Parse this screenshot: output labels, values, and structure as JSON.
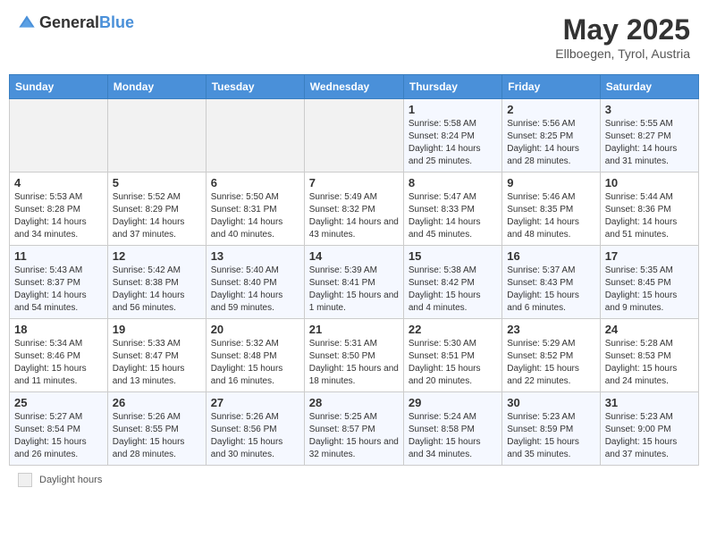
{
  "header": {
    "logo_general": "General",
    "logo_blue": "Blue",
    "month_title": "May 2025",
    "subtitle": "Ellboegen, Tyrol, Austria"
  },
  "legend": {
    "label": "Daylight hours"
  },
  "days_of_week": [
    "Sunday",
    "Monday",
    "Tuesday",
    "Wednesday",
    "Thursday",
    "Friday",
    "Saturday"
  ],
  "weeks": [
    [
      {
        "day": "",
        "detail": ""
      },
      {
        "day": "",
        "detail": ""
      },
      {
        "day": "",
        "detail": ""
      },
      {
        "day": "",
        "detail": ""
      },
      {
        "day": "1",
        "detail": "Sunrise: 5:58 AM\nSunset: 8:24 PM\nDaylight: 14 hours and 25 minutes."
      },
      {
        "day": "2",
        "detail": "Sunrise: 5:56 AM\nSunset: 8:25 PM\nDaylight: 14 hours and 28 minutes."
      },
      {
        "day": "3",
        "detail": "Sunrise: 5:55 AM\nSunset: 8:27 PM\nDaylight: 14 hours and 31 minutes."
      }
    ],
    [
      {
        "day": "4",
        "detail": "Sunrise: 5:53 AM\nSunset: 8:28 PM\nDaylight: 14 hours and 34 minutes."
      },
      {
        "day": "5",
        "detail": "Sunrise: 5:52 AM\nSunset: 8:29 PM\nDaylight: 14 hours and 37 minutes."
      },
      {
        "day": "6",
        "detail": "Sunrise: 5:50 AM\nSunset: 8:31 PM\nDaylight: 14 hours and 40 minutes."
      },
      {
        "day": "7",
        "detail": "Sunrise: 5:49 AM\nSunset: 8:32 PM\nDaylight: 14 hours and 43 minutes."
      },
      {
        "day": "8",
        "detail": "Sunrise: 5:47 AM\nSunset: 8:33 PM\nDaylight: 14 hours and 45 minutes."
      },
      {
        "day": "9",
        "detail": "Sunrise: 5:46 AM\nSunset: 8:35 PM\nDaylight: 14 hours and 48 minutes."
      },
      {
        "day": "10",
        "detail": "Sunrise: 5:44 AM\nSunset: 8:36 PM\nDaylight: 14 hours and 51 minutes."
      }
    ],
    [
      {
        "day": "11",
        "detail": "Sunrise: 5:43 AM\nSunset: 8:37 PM\nDaylight: 14 hours and 54 minutes."
      },
      {
        "day": "12",
        "detail": "Sunrise: 5:42 AM\nSunset: 8:38 PM\nDaylight: 14 hours and 56 minutes."
      },
      {
        "day": "13",
        "detail": "Sunrise: 5:40 AM\nSunset: 8:40 PM\nDaylight: 14 hours and 59 minutes."
      },
      {
        "day": "14",
        "detail": "Sunrise: 5:39 AM\nSunset: 8:41 PM\nDaylight: 15 hours and 1 minute."
      },
      {
        "day": "15",
        "detail": "Sunrise: 5:38 AM\nSunset: 8:42 PM\nDaylight: 15 hours and 4 minutes."
      },
      {
        "day": "16",
        "detail": "Sunrise: 5:37 AM\nSunset: 8:43 PM\nDaylight: 15 hours and 6 minutes."
      },
      {
        "day": "17",
        "detail": "Sunrise: 5:35 AM\nSunset: 8:45 PM\nDaylight: 15 hours and 9 minutes."
      }
    ],
    [
      {
        "day": "18",
        "detail": "Sunrise: 5:34 AM\nSunset: 8:46 PM\nDaylight: 15 hours and 11 minutes."
      },
      {
        "day": "19",
        "detail": "Sunrise: 5:33 AM\nSunset: 8:47 PM\nDaylight: 15 hours and 13 minutes."
      },
      {
        "day": "20",
        "detail": "Sunrise: 5:32 AM\nSunset: 8:48 PM\nDaylight: 15 hours and 16 minutes."
      },
      {
        "day": "21",
        "detail": "Sunrise: 5:31 AM\nSunset: 8:50 PM\nDaylight: 15 hours and 18 minutes."
      },
      {
        "day": "22",
        "detail": "Sunrise: 5:30 AM\nSunset: 8:51 PM\nDaylight: 15 hours and 20 minutes."
      },
      {
        "day": "23",
        "detail": "Sunrise: 5:29 AM\nSunset: 8:52 PM\nDaylight: 15 hours and 22 minutes."
      },
      {
        "day": "24",
        "detail": "Sunrise: 5:28 AM\nSunset: 8:53 PM\nDaylight: 15 hours and 24 minutes."
      }
    ],
    [
      {
        "day": "25",
        "detail": "Sunrise: 5:27 AM\nSunset: 8:54 PM\nDaylight: 15 hours and 26 minutes."
      },
      {
        "day": "26",
        "detail": "Sunrise: 5:26 AM\nSunset: 8:55 PM\nDaylight: 15 hours and 28 minutes."
      },
      {
        "day": "27",
        "detail": "Sunrise: 5:26 AM\nSunset: 8:56 PM\nDaylight: 15 hours and 30 minutes."
      },
      {
        "day": "28",
        "detail": "Sunrise: 5:25 AM\nSunset: 8:57 PM\nDaylight: 15 hours and 32 minutes."
      },
      {
        "day": "29",
        "detail": "Sunrise: 5:24 AM\nSunset: 8:58 PM\nDaylight: 15 hours and 34 minutes."
      },
      {
        "day": "30",
        "detail": "Sunrise: 5:23 AM\nSunset: 8:59 PM\nDaylight: 15 hours and 35 minutes."
      },
      {
        "day": "31",
        "detail": "Sunrise: 5:23 AM\nSunset: 9:00 PM\nDaylight: 15 hours and 37 minutes."
      }
    ]
  ]
}
